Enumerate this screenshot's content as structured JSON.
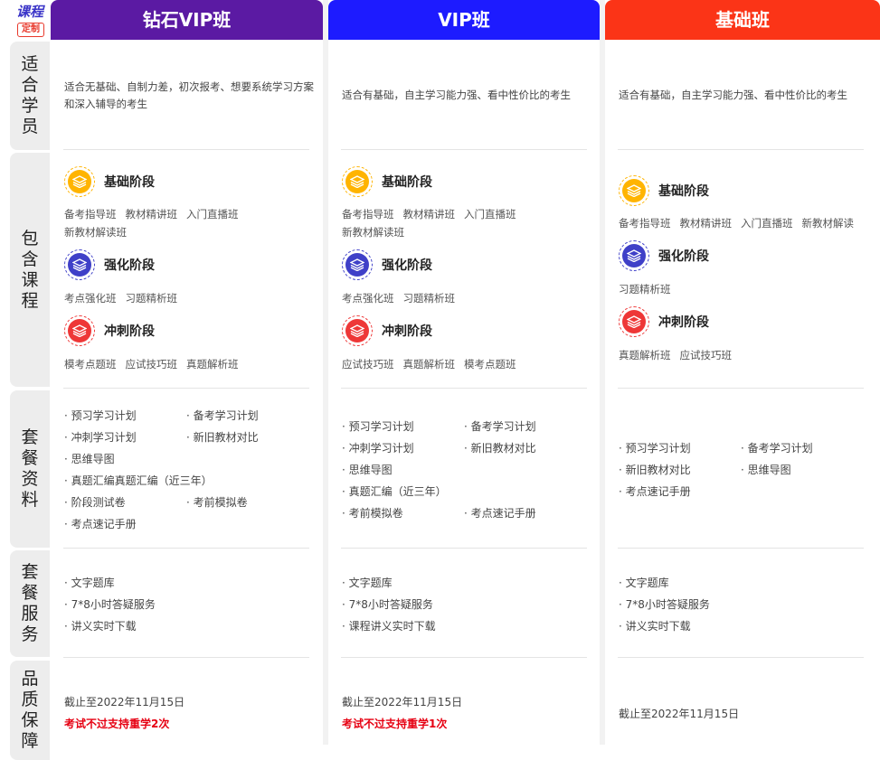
{
  "logo": {
    "top": "课程",
    "badge": "定制"
  },
  "row_labels": [
    "适合学员",
    "包含课程",
    "套餐资料",
    "套餐服务",
    "品质保障"
  ],
  "colors": {
    "diamond": "#5b1aa3",
    "vip": "#1d1bff",
    "basic": "#fb3417",
    "stage_basic": "#ffb400",
    "stage_adv": "#3f40c8",
    "stage_sprint": "#ee3737",
    "guarantee_red": "#e60012"
  },
  "stage_names": {
    "basic": "基础阶段",
    "adv": "强化阶段",
    "sprint": "冲刺阶段"
  },
  "plans": [
    {
      "name": "钻石VIP班",
      "intro_l1": "适合无基础、自制力差，初次报考、想要系统学习方案",
      "intro_l2": "和深入辅导的考生",
      "basic_items": [
        "备考指导班",
        "教材精讲班",
        "入门直播班",
        "新教材解读班"
      ],
      "adv_items": [
        "考点强化班",
        "习题精析班"
      ],
      "sprint_items": [
        "模考点题班",
        "应试技巧班",
        "真题解析班"
      ],
      "materials": [
        "· 预习学习计划",
        "· 备考学习计划",
        "· 冲刺学习计划",
        "· 新旧教材对比",
        "· 思维导图",
        "· 真题汇编真题汇编（近三年）",
        "· 阶段测试卷",
        "· 考前模拟卷",
        "· 考点速记手册"
      ],
      "services": [
        "· 文字题库",
        "· 7*8小时答疑服务",
        "· 讲义实时下载"
      ],
      "deadline": "截止至2022年11月15日",
      "guarantee": "考试不过支持重学2次"
    },
    {
      "name": "VIP班",
      "intro_l1": "适合有基础，自主学习能力强、看中性价比的考生",
      "basic_items": [
        "备考指导班",
        "教材精讲班",
        "入门直播班",
        "新教材解读班"
      ],
      "adv_items": [
        "考点强化班",
        "习题精析班"
      ],
      "sprint_items": [
        "应试技巧班",
        "真题解析班",
        "模考点题班"
      ],
      "materials": [
        "· 预习学习计划",
        "· 备考学习计划",
        "· 冲刺学习计划",
        "· 新旧教材对比",
        "· 思维导图",
        "· 真题汇编（近三年）",
        "· 考前模拟卷",
        "· 考点速记手册"
      ],
      "services": [
        "· 文字题库",
        "· 7*8小时答疑服务",
        "· 课程讲义实时下载"
      ],
      "deadline": "截止至2022年11月15日",
      "guarantee": "考试不过支持重学1次"
    },
    {
      "name": "基础班",
      "intro_l1": "适合有基础，自主学习能力强、看中性价比的考生",
      "basic_items": [
        "备考指导班",
        "教材精讲班",
        "入门直播班",
        "新教材解读"
      ],
      "adv_items": [
        "习题精析班"
      ],
      "sprint_items": [
        "真题解析班",
        "应试技巧班"
      ],
      "materials": [
        "· 预习学习计划",
        "· 备考学习计划",
        "· 新旧教材对比",
        "· 思维导图",
        "· 考点速记手册"
      ],
      "services": [
        "· 文字题库",
        "· 7*8小时答疑服务",
        "· 讲义实时下载"
      ],
      "deadline": "截止至2022年11月15日"
    }
  ]
}
